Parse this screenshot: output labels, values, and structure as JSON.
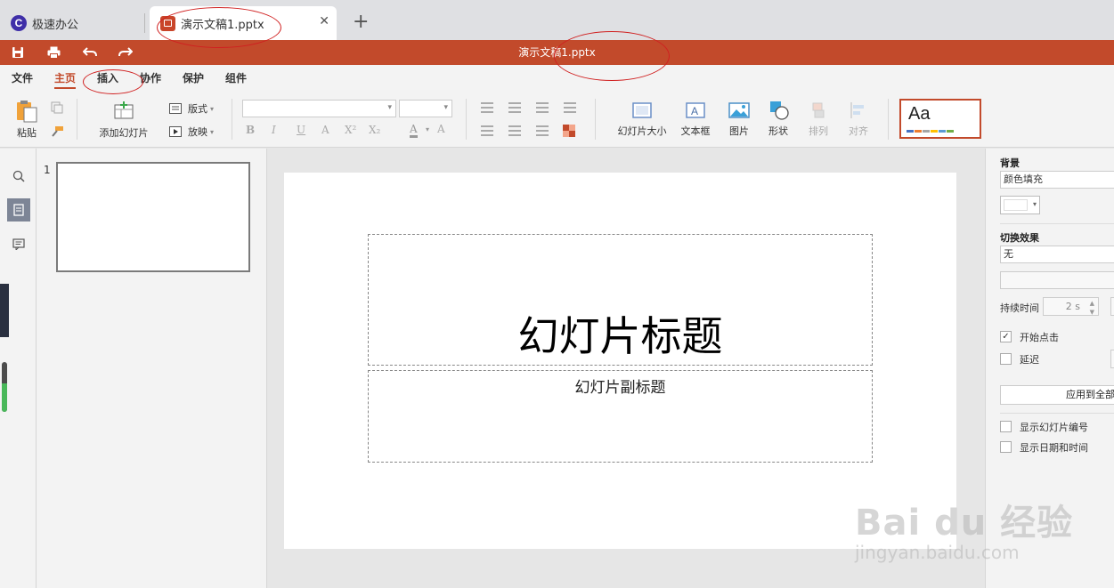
{
  "tabs": {
    "home_label": "极速办公",
    "doc_label": "演示文稿1.pptx",
    "close_glyph": "✕",
    "new_tab_glyph": "+"
  },
  "titlebar": {
    "title": "演示文稿1.pptx"
  },
  "menu": {
    "items": [
      "文件",
      "主页",
      "插入",
      "协作",
      "保护",
      "组件"
    ],
    "active": "主页"
  },
  "ribbon": {
    "paste_label": "粘贴",
    "add_slide_label": "添加幻灯片",
    "layout_label": "版式",
    "play_label": "放映",
    "slide_size_label": "幻灯片大小",
    "textbox_label": "文本框",
    "image_label": "图片",
    "shape_label": "形状",
    "arrange_label": "排列",
    "align_label": "对齐",
    "theme_preview_text": "Aa",
    "font_style_glyphs": [
      "B",
      "I",
      "U",
      "A",
      "X²",
      "X₂"
    ]
  },
  "thumbnails": [
    {
      "number": "1"
    }
  ],
  "slide": {
    "title": "幻灯片标题",
    "subtitle": "幻灯片副标题"
  },
  "properties": {
    "background_label": "背景",
    "background_fill": "颜色填充",
    "transition_label": "切换效果",
    "transition_value": "无",
    "duration_label": "持续时间",
    "duration_value": "2 s",
    "start_on_click_label": "开始点击",
    "start_on_click_checked": true,
    "delay_label": "延迟",
    "delay_checked": false,
    "apply_all_label": "应用到全部",
    "show_slide_number_label": "显示幻灯片编号",
    "show_datetime_label": "显示日期和时间"
  },
  "watermark": {
    "main": "Bai du 经验",
    "sub": "jingyan.baidu.com"
  },
  "colors": {
    "accent": "#c24a2b",
    "app_logo": "#3f2fa8",
    "annotation": "#d02020"
  }
}
